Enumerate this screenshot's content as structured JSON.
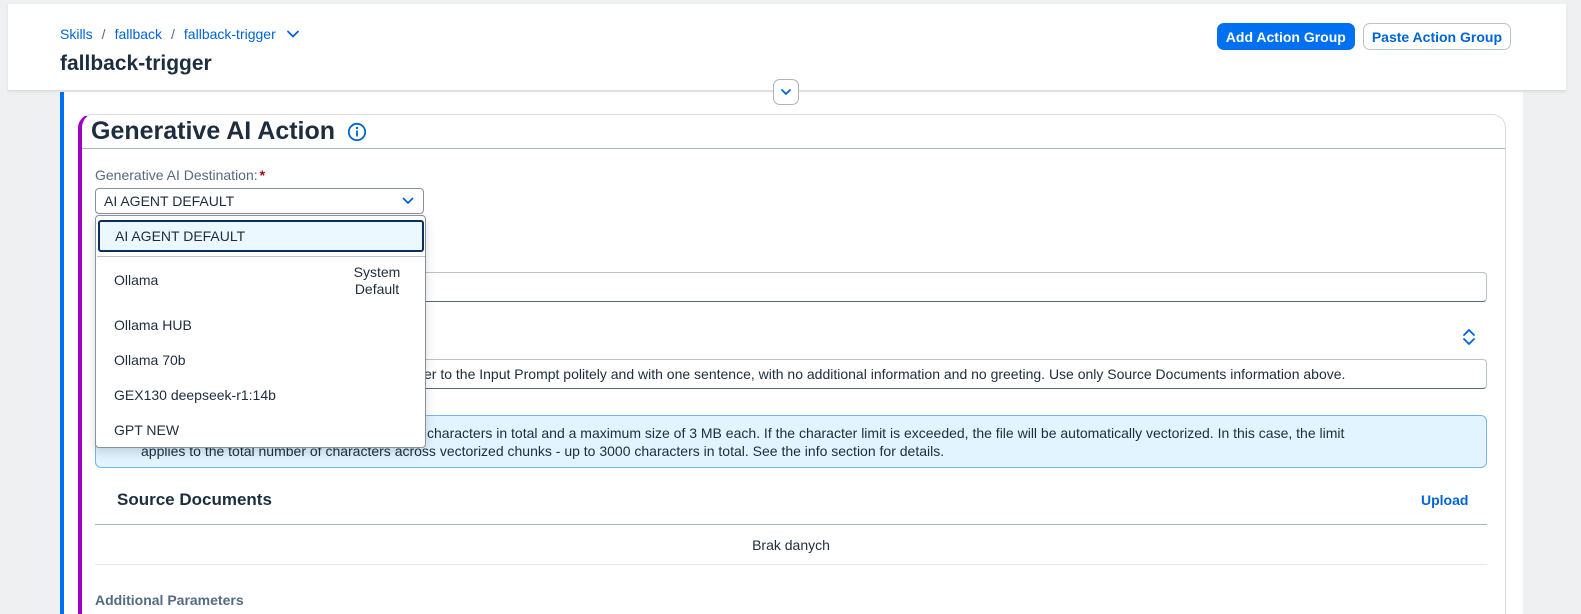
{
  "header": {
    "breadcrumb": [
      "Skills",
      "fallback",
      "fallback-trigger"
    ],
    "title": "fallback-trigger",
    "add_action_group": "Add Action Group",
    "paste_action_group": "Paste Action Group"
  },
  "card": {
    "title": "Generative AI Action",
    "destination_label": "Generative AI Destination:",
    "required_mark": "*",
    "destination_value": "AI AGENT DEFAULT",
    "instructions_text": "er to the Input Prompt politely and with one sentence, with no additional information and no greeting. Use only Source Documents information above.",
    "info_line1": "characters in total and a maximum size of 3 MB each. If the character limit is exceeded, the file will be automatically vectorized. In this case, the limit",
    "info_line2": "applies to the total number of characters across vectorized chunks - up to 3000 characters in total. See the info section for details.",
    "source_documents_title": "Source Documents",
    "upload_label": "Upload",
    "no_data": "Brak danych",
    "additional_parameters": "Additional Parameters"
  },
  "dropdown": {
    "items": [
      {
        "label": "AI AGENT DEFAULT",
        "selected": true
      },
      {
        "label": "Ollama",
        "secondary": "System Default"
      },
      {
        "label": "Ollama HUB"
      },
      {
        "label": "Ollama 70b"
      },
      {
        "label": "GEX130 deepseek-r1:14b"
      },
      {
        "label": "GPT NEW"
      }
    ]
  },
  "colors": {
    "accent": "#0070f2",
    "card_accent": "#a100c2",
    "info_bg": "#e1f4ff"
  },
  "icons": [
    "chevron-down-icon",
    "info-icon",
    "sort-icon",
    "collapse-chevron-icon"
  ]
}
